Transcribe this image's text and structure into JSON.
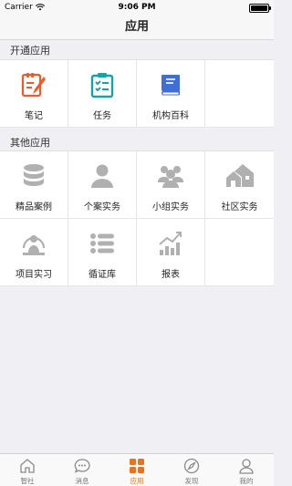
{
  "status_bar": {
    "carrier": "Carrier",
    "time": "9:06 PM"
  },
  "nav": {
    "title": "应用"
  },
  "sections": {
    "opened": {
      "title": "开通应用",
      "items": [
        {
          "label": "笔记",
          "icon": "notebook-pen-icon"
        },
        {
          "label": "任务",
          "icon": "task-clipboard-icon"
        },
        {
          "label": "机构百科",
          "icon": "book-icon"
        }
      ]
    },
    "other": {
      "title": "其他应用",
      "items": [
        {
          "label": "精品案例",
          "icon": "database-icon"
        },
        {
          "label": "个案实务",
          "icon": "person-icon"
        },
        {
          "label": "小组实务",
          "icon": "group-icon"
        },
        {
          "label": "社区实务",
          "icon": "houses-icon"
        },
        {
          "label": "项目实习",
          "icon": "presenter-icon"
        },
        {
          "label": "循证库",
          "icon": "list-icon"
        },
        {
          "label": "报表",
          "icon": "bar-chart-icon"
        }
      ]
    }
  },
  "tabs": [
    {
      "label": "智社",
      "icon": "home-icon"
    },
    {
      "label": "消息",
      "icon": "message-icon"
    },
    {
      "label": "应用",
      "icon": "apps-icon",
      "active": true
    },
    {
      "label": "发现",
      "icon": "compass-icon"
    },
    {
      "label": "我的",
      "icon": "user-icon"
    }
  ],
  "colors": {
    "accent": "#e8731f",
    "notes": "#f05a28",
    "tasks": "#16a3a8",
    "book": "#3f6fd6",
    "gray_icon": "#b0b0b0"
  }
}
